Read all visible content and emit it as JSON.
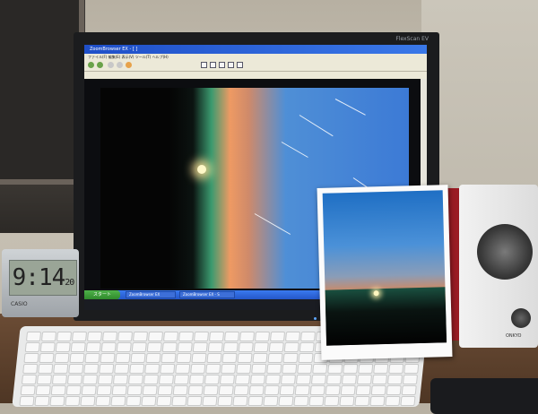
{
  "monitor": {
    "brand": "FlexScan EV"
  },
  "app": {
    "title": "ZoomBrowser EX - [ ]",
    "menu": "ファイル(F)  編集(E)  表示(V)  ツール(T)  ヘルプ(H)",
    "address": "",
    "taskbar": {
      "start": "スタート",
      "items": [
        "ZoomBrowser EX",
        "ZoomBrowser EX - S"
      ]
    }
  },
  "clock": {
    "time": "9:14",
    "seconds": "20",
    "brand": "CASIO"
  },
  "speaker": {
    "brand": "ONKYO"
  },
  "colors": {
    "sky": "#3c7ad6",
    "horizon": "#ee9a63",
    "taskbar": "#2456c8"
  }
}
